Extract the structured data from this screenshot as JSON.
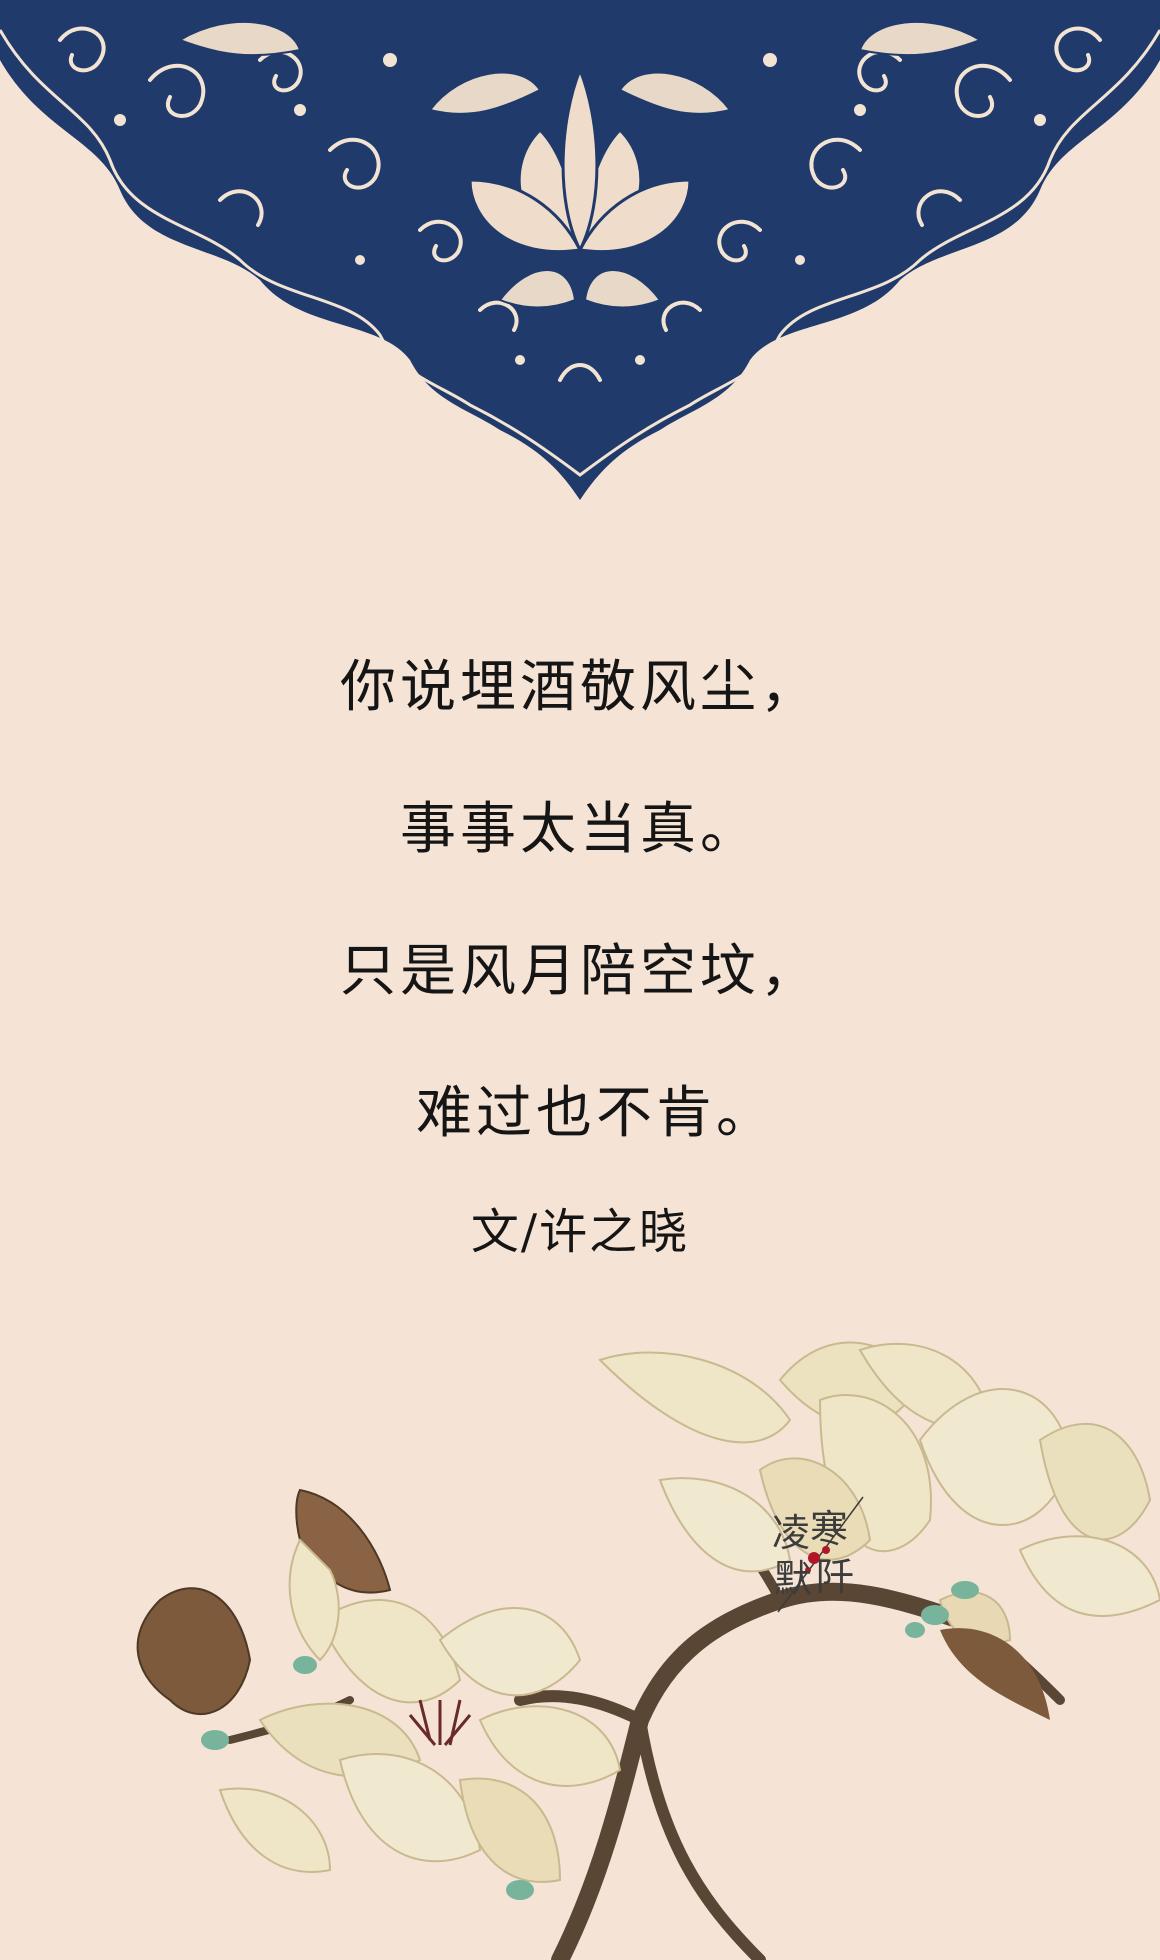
{
  "poem": {
    "lines": [
      "你说埋酒敬风尘，",
      "事事太当真。",
      "只是风月陪空坟，",
      "难过也不肯。"
    ],
    "author": "文/许之晓"
  },
  "seal": {
    "chars": [
      "凌",
      "寒",
      "默",
      "阡"
    ]
  },
  "colors": {
    "background": "#f5e4d6",
    "ornament_blue": "#1f3a6b",
    "ornament_cream": "#f3e3d3",
    "magnolia_petal": "#efe6c8",
    "magnolia_bud": "#7d5a3c",
    "branch": "#5a4634",
    "leaf_green": "#78b39c",
    "text": "#151515",
    "seal_red": "#b0182a"
  }
}
